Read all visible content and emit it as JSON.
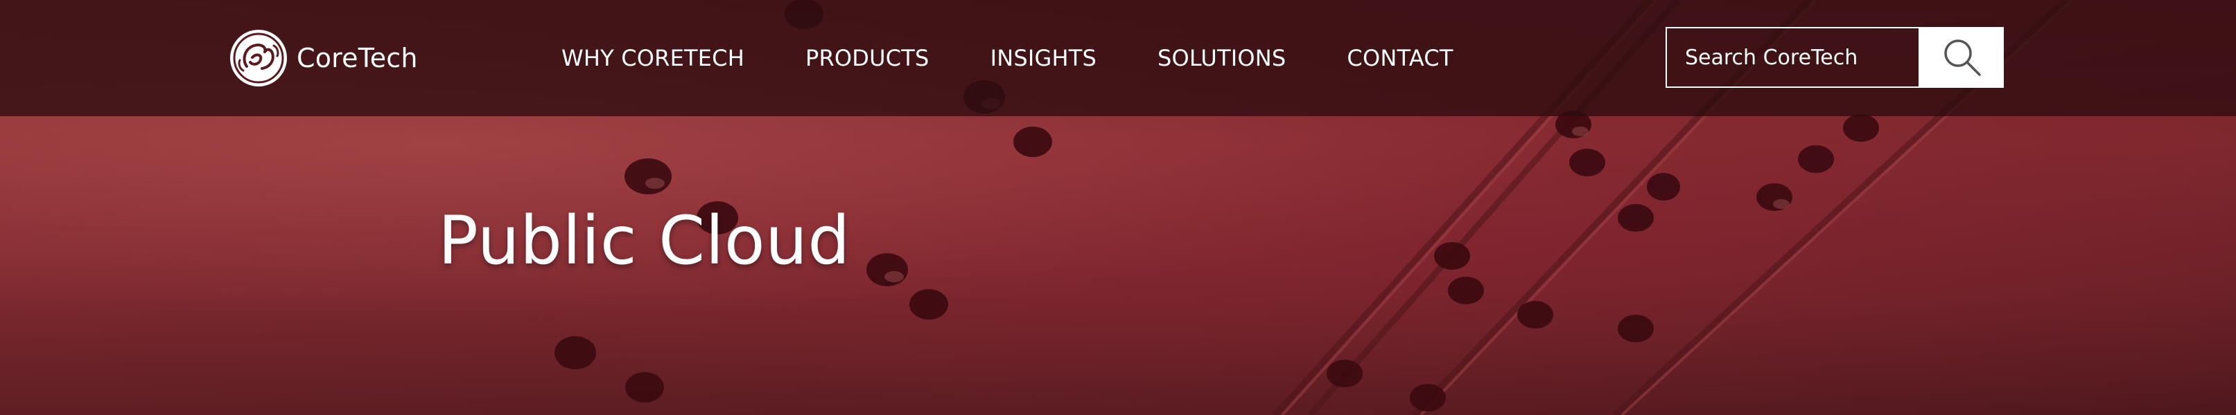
{
  "brand": {
    "name": "CoreTech",
    "logo_icon": "monogram-logo-icon"
  },
  "nav": {
    "items": [
      {
        "label": "WHY CORETECH"
      },
      {
        "label": "PRODUCTS"
      },
      {
        "label": "INSIGHTS"
      },
      {
        "label": "SOLUTIONS"
      },
      {
        "label": "CONTACT"
      }
    ]
  },
  "search": {
    "placeholder": "Search CoreTech",
    "icon": "search-icon"
  },
  "hero": {
    "title": "Public Cloud",
    "background": "red riveted metal texture"
  },
  "colors": {
    "nav_background": "#2d0c10",
    "hero_background": "#8c2f34",
    "text": "#ffffff",
    "search_button": "#ffffff"
  }
}
